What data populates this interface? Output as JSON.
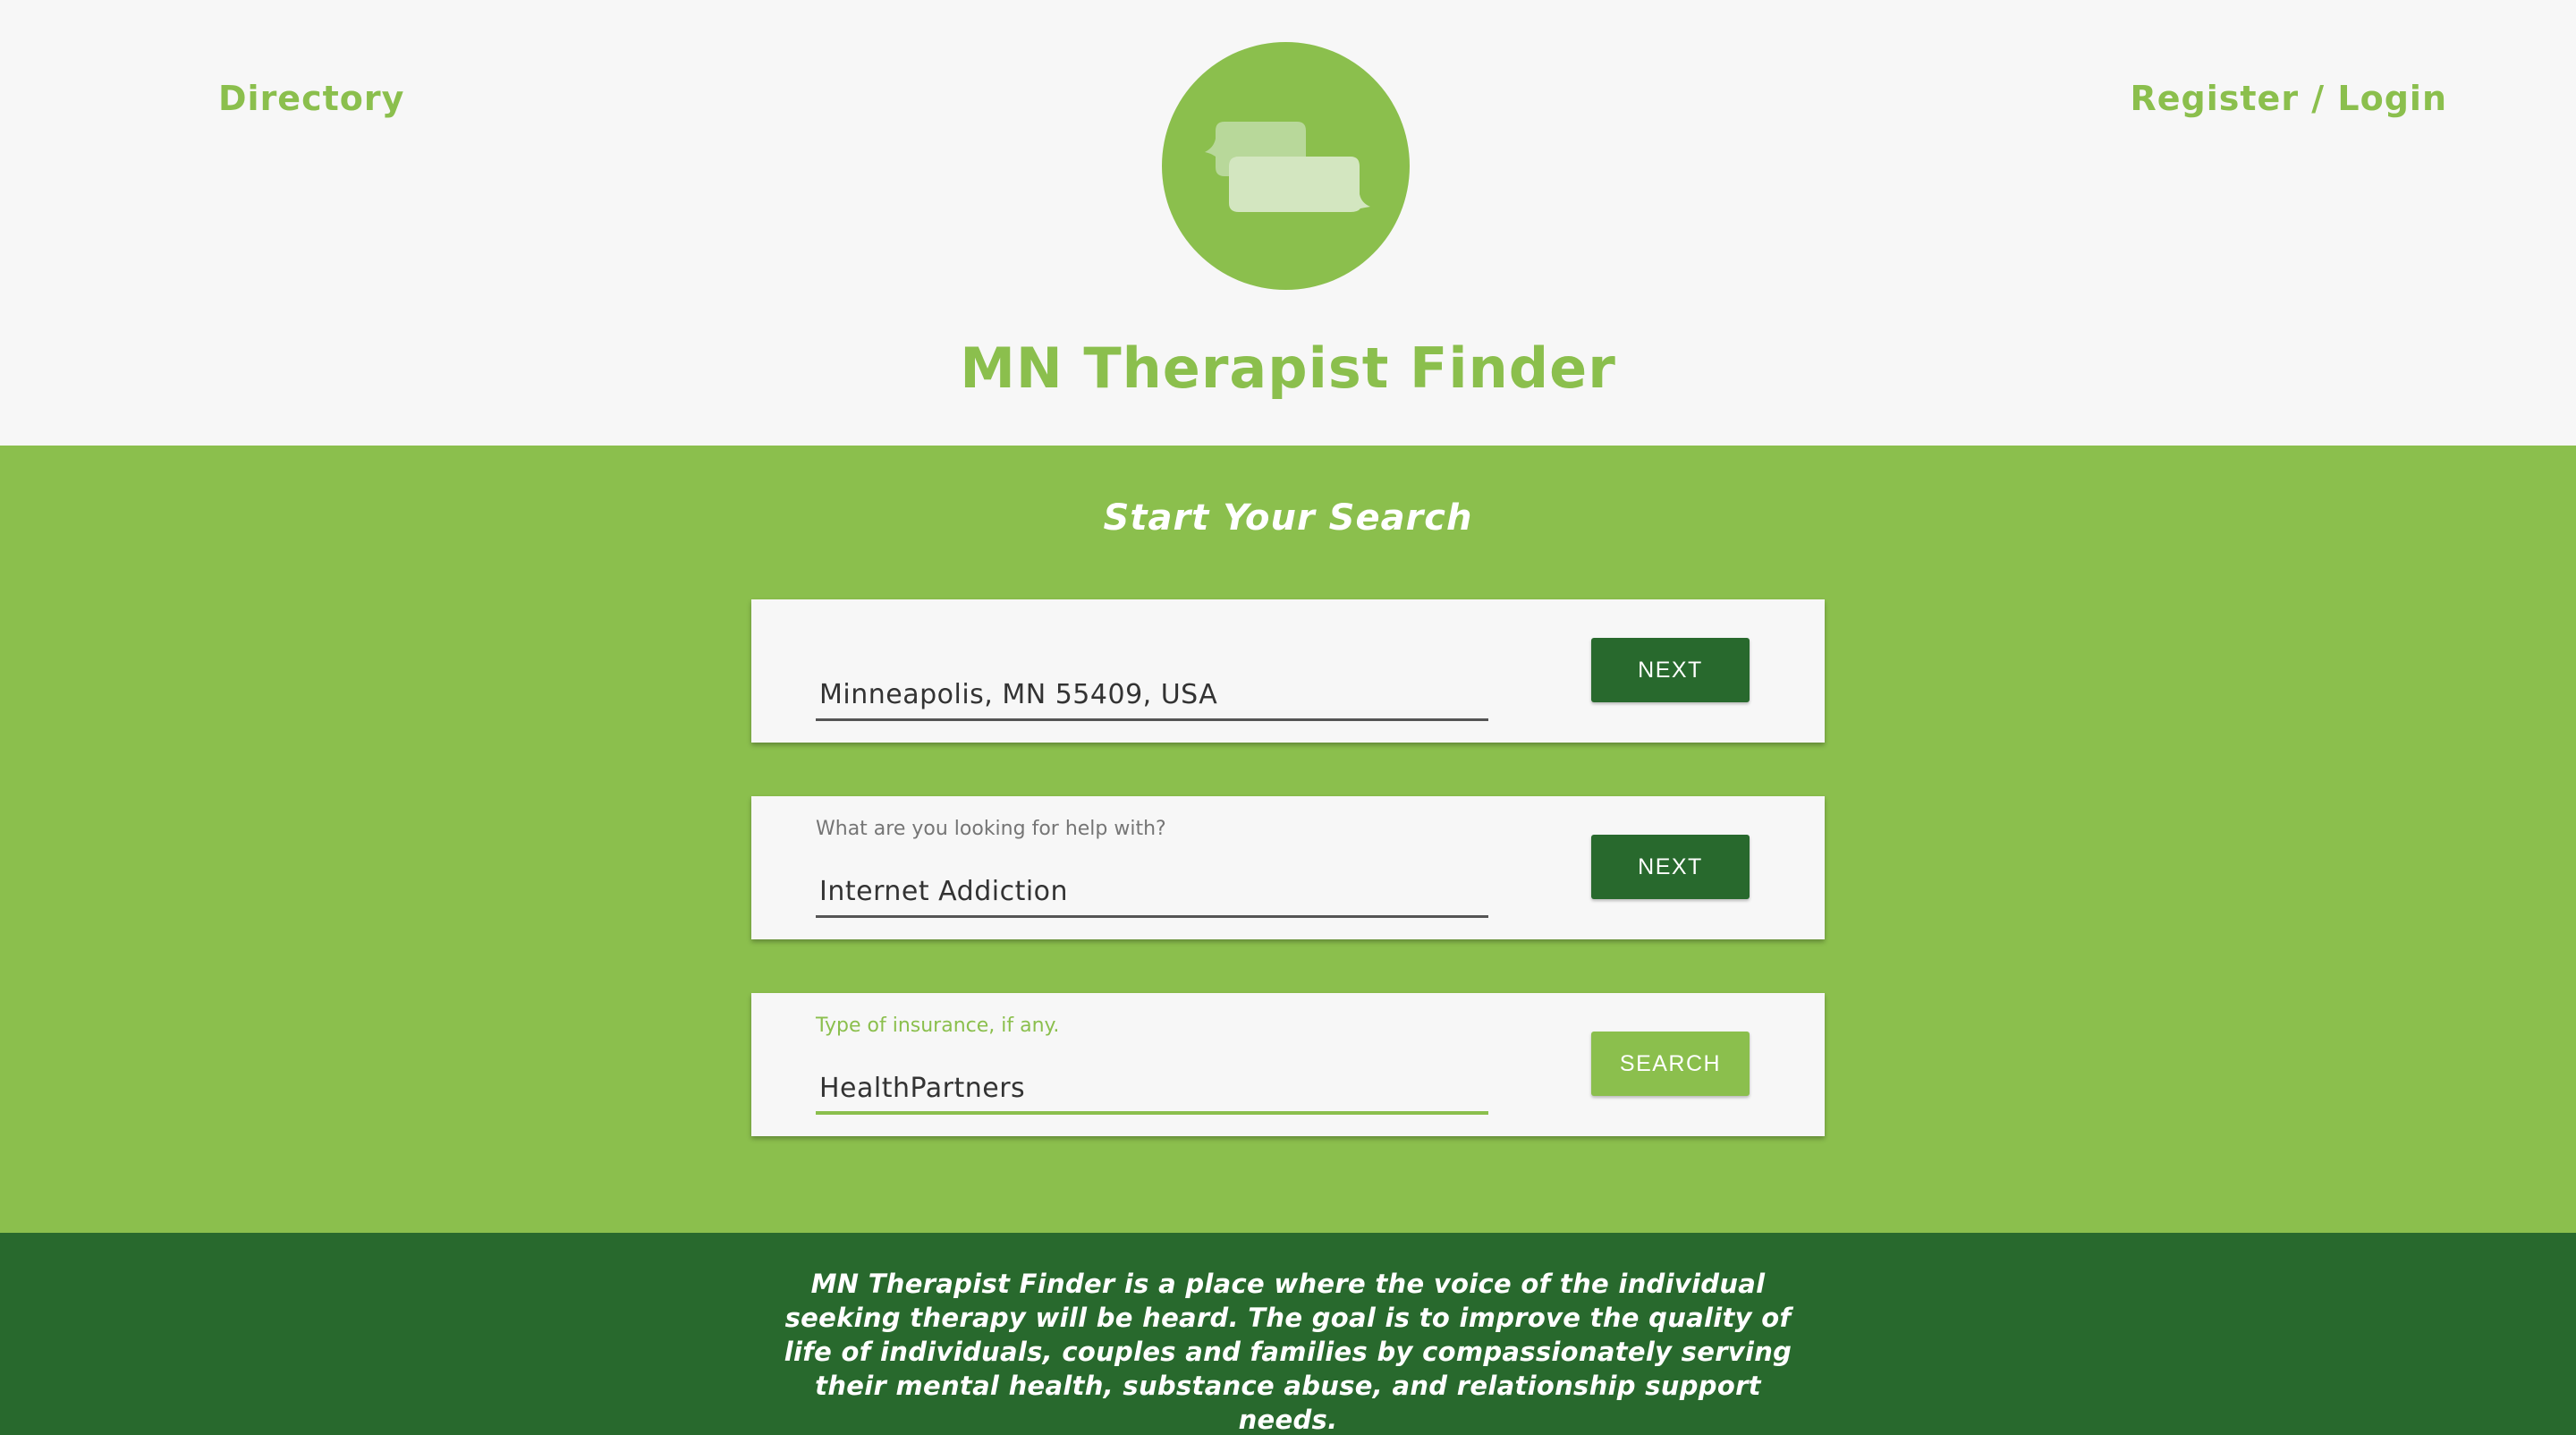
{
  "nav": {
    "directory_label": "Directory",
    "login_label": "Register / Login"
  },
  "logo": {
    "icon": "chat-bubbles-icon"
  },
  "site_title": "MN Therapist Finder",
  "search": {
    "heading": "Start Your Search",
    "location": {
      "label": "",
      "value": "Minneapolis, MN 55409, USA",
      "button_label": "NEXT"
    },
    "help_topic": {
      "label": "What are you looking for help with?",
      "value": "Internet Addiction",
      "button_label": "NEXT"
    },
    "insurance": {
      "label": "Type of insurance, if any.",
      "value": "HealthPartners",
      "button_label": "SEARCH"
    }
  },
  "footer": {
    "text": "MN Therapist Finder is a place where the voice of the individual seeking therapy will be heard. The goal is to improve the quality of life of individuals, couples and families by compassionately serving their mental health, substance abuse, and relationship support needs."
  },
  "colors": {
    "brand_green": "#8bbf4d",
    "dark_green": "#28692d",
    "background": "#f7f7f7"
  }
}
